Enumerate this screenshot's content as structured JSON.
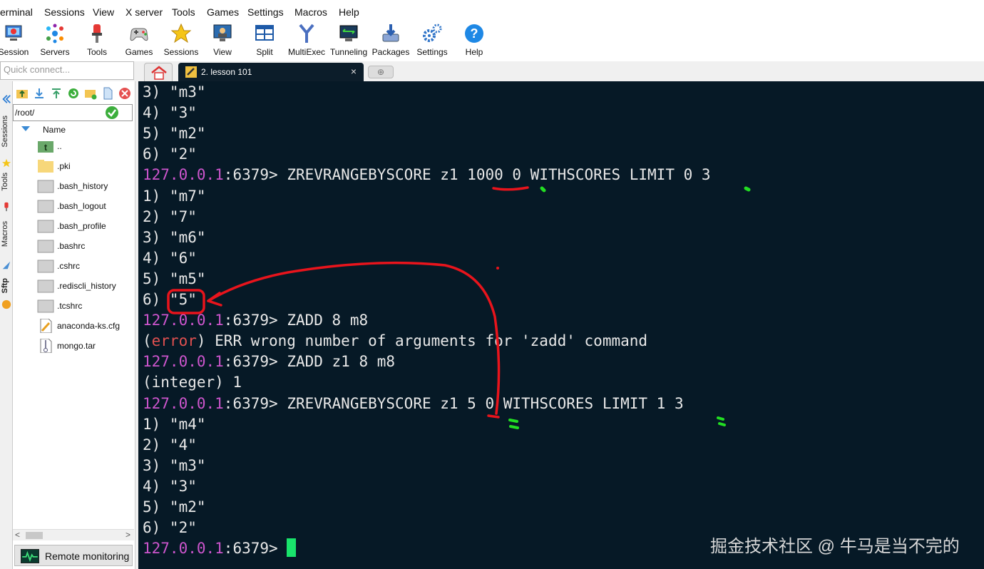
{
  "menu": [
    "erminal",
    "Sessions",
    "View",
    "X server",
    "Tools",
    "Games",
    "Settings",
    "Macros",
    "Help"
  ],
  "toolbar": [
    {
      "label": "Session",
      "icon": "session-icon"
    },
    {
      "label": "Servers",
      "icon": "servers-icon"
    },
    {
      "label": "Tools",
      "icon": "tools-icon"
    },
    {
      "label": "Games",
      "icon": "games-icon"
    },
    {
      "label": "Sessions",
      "icon": "star-icon"
    },
    {
      "label": "View",
      "icon": "view-icon"
    },
    {
      "label": "Split",
      "icon": "split-icon"
    },
    {
      "label": "MultiExec",
      "icon": "multiexec-icon"
    },
    {
      "label": "Tunneling",
      "icon": "tunneling-icon"
    },
    {
      "label": "Packages",
      "icon": "packages-icon"
    },
    {
      "label": "Settings",
      "icon": "gears-icon"
    },
    {
      "label": "Help",
      "icon": "help-icon"
    }
  ],
  "quick_connect": {
    "placeholder": "Quick connect..."
  },
  "tabs": {
    "active_label": "2. lesson 101",
    "close": "×",
    "new": "⊕"
  },
  "side_tabs": [
    "Sessions",
    "Tools",
    "Macros",
    "Sftp"
  ],
  "sftp": {
    "path": "/root/",
    "column": "Name",
    "files": [
      {
        "name": "..",
        "icon": "parent-folder-icon"
      },
      {
        "name": ".pki",
        "icon": "folder-icon"
      },
      {
        "name": ".bash_history",
        "icon": "file-icon"
      },
      {
        "name": ".bash_logout",
        "icon": "file-icon"
      },
      {
        "name": ".bash_profile",
        "icon": "file-icon"
      },
      {
        "name": ".bashrc",
        "icon": "file-icon"
      },
      {
        "name": ".cshrc",
        "icon": "file-icon"
      },
      {
        "name": ".rediscli_history",
        "icon": "file-icon"
      },
      {
        "name": ".tcshrc",
        "icon": "file-icon"
      },
      {
        "name": "anaconda-ks.cfg",
        "icon": "config-file-icon"
      },
      {
        "name": "mongo.tar",
        "icon": "archive-file-icon"
      }
    ],
    "remote_monitoring": "Remote monitoring",
    "scroll_left": "<",
    "scroll_right": ">"
  },
  "terminal": {
    "prompt_ip": "127.0.0.1",
    "prompt_rest": ":6379> ",
    "lines": [
      {
        "type": "out",
        "text": "3) \"m3\""
      },
      {
        "type": "out",
        "text": "4) \"3\""
      },
      {
        "type": "out",
        "text": "5) \"m2\""
      },
      {
        "type": "out",
        "text": "6) \"2\""
      },
      {
        "type": "cmd",
        "text": "ZREVRANGEBYSCORE z1 1000 0 WITHSCORES LIMIT 0 3"
      },
      {
        "type": "out",
        "text": "1) \"m7\""
      },
      {
        "type": "out",
        "text": "2) \"7\""
      },
      {
        "type": "out",
        "text": "3) \"m6\""
      },
      {
        "type": "out",
        "text": "4) \"6\""
      },
      {
        "type": "out",
        "text": "5) \"m5\""
      },
      {
        "type": "out",
        "text": "6) \"5\""
      },
      {
        "type": "cmd",
        "text": "ZADD 8 m8"
      },
      {
        "type": "err",
        "prefix": "(",
        "word": "error",
        "text": ") ERR wrong number of arguments for 'zadd' command"
      },
      {
        "type": "cmd",
        "text": "ZADD z1 8 m8"
      },
      {
        "type": "out",
        "text": "(integer) 1"
      },
      {
        "type": "cmd",
        "text": "ZREVRANGEBYSCORE z1 5 0 WITHSCORES LIMIT 1 3"
      },
      {
        "type": "out",
        "text": "1) \"m4\""
      },
      {
        "type": "out",
        "text": "2) \"4\""
      },
      {
        "type": "out",
        "text": "3) \"m3\""
      },
      {
        "type": "out",
        "text": "4) \"3\""
      },
      {
        "type": "out",
        "text": "5) \"m2\""
      },
      {
        "type": "out",
        "text": "6) \"2\""
      },
      {
        "type": "prompt",
        "text": ""
      }
    ]
  },
  "watermark": "掘金技术社区 @ 牛马是当不完的",
  "colors": {
    "terminal_bg": "#061926",
    "prompt": "#cc55cc",
    "error": "#e05050",
    "cursor": "#19e36b",
    "annotation_red": "#e8141c",
    "annotation_green": "#22dd22"
  }
}
